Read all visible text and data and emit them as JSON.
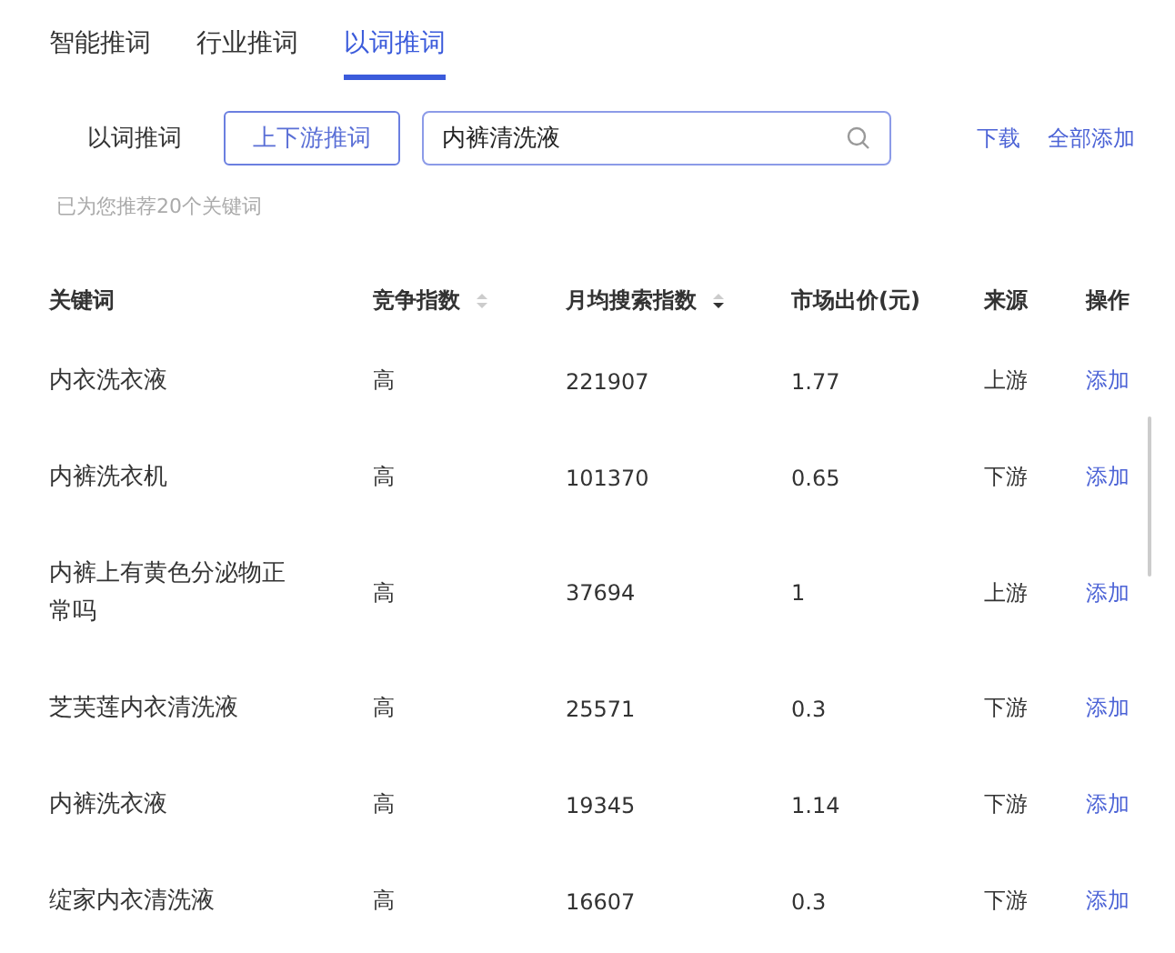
{
  "tabs": [
    {
      "label": "智能推词",
      "selected": false
    },
    {
      "label": "行业推词",
      "selected": false
    },
    {
      "label": "以词推词",
      "selected": true
    }
  ],
  "modes": [
    {
      "label": "以词推词",
      "selected": false
    },
    {
      "label": "上下游推词",
      "selected": true
    }
  ],
  "search": {
    "value": "内裤清洗液"
  },
  "actions": [
    "下载",
    "全部添加"
  ],
  "hint": "已为您推荐20个关键词",
  "table": {
    "columns": [
      {
        "label": "关键词",
        "sortable": false
      },
      {
        "label": "竞争指数",
        "sortable": true,
        "sorted_desc": false
      },
      {
        "label": "月均搜索指数",
        "sortable": true,
        "sorted_desc": true
      },
      {
        "label": "市场出价(元)",
        "sortable": false
      },
      {
        "label": "来源",
        "sortable": false
      },
      {
        "label": "操作",
        "sortable": false
      }
    ],
    "rows": [
      {
        "keyword": "内衣洗衣液",
        "competition": "高",
        "monthly_search": "221907",
        "bid": "1.77",
        "source": "上游",
        "action": "添加"
      },
      {
        "keyword": "内裤洗衣机",
        "competition": "高",
        "monthly_search": "101370",
        "bid": "0.65",
        "source": "下游",
        "action": "添加"
      },
      {
        "keyword": "内裤上有黄色分泌物正常吗",
        "competition": "高",
        "monthly_search": "37694",
        "bid": "1",
        "source": "上游",
        "action": "添加"
      },
      {
        "keyword": "芝芙莲内衣清洗液",
        "competition": "高",
        "monthly_search": "25571",
        "bid": "0.3",
        "source": "下游",
        "action": "添加"
      },
      {
        "keyword": "内裤洗衣液",
        "competition": "高",
        "monthly_search": "19345",
        "bid": "1.14",
        "source": "下游",
        "action": "添加"
      },
      {
        "keyword": "绽家内衣清洗液",
        "competition": "高",
        "monthly_search": "16607",
        "bid": "0.3",
        "source": "下游",
        "action": "添加"
      }
    ]
  }
}
